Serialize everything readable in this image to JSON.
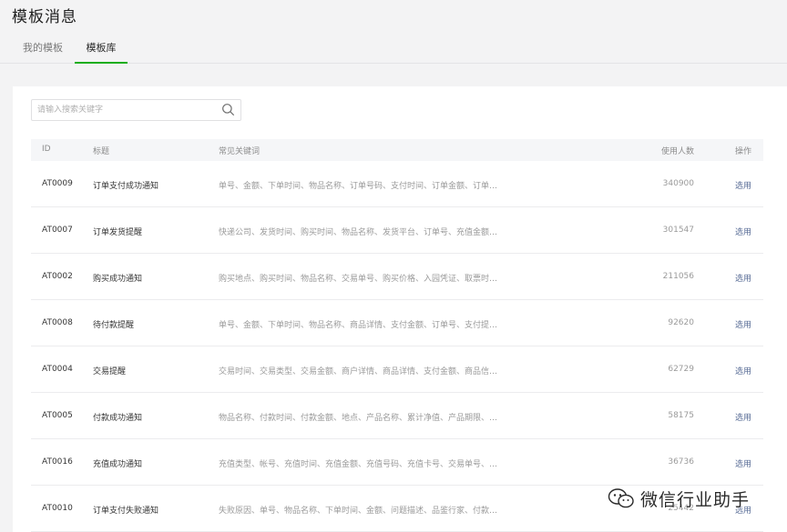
{
  "page": {
    "title": "模板消息"
  },
  "tabs": [
    {
      "label": "我的模板",
      "active": false
    },
    {
      "label": "模板库",
      "active": true
    }
  ],
  "search": {
    "placeholder": "请输入搜索关键字",
    "value": ""
  },
  "table": {
    "headers": {
      "id": "ID",
      "title": "标题",
      "keywords": "常见关键词",
      "users": "使用人数",
      "op": "操作"
    },
    "rows": [
      {
        "id": "AT0009",
        "title": "订单支付成功通知",
        "keywords": "单号、金额、下单时间、物品名称、订单号码、支付时间、订单金额、订单…",
        "users": "340900",
        "op": "选用"
      },
      {
        "id": "AT0007",
        "title": "订单发货提醒",
        "keywords": "快递公司、发货时间、购买时间、物品名称、发货平台、订单号、充值金额…",
        "users": "301547",
        "op": "选用"
      },
      {
        "id": "AT0002",
        "title": "购买成功通知",
        "keywords": "购买地点、购买时间、物品名称、交易单号、购买价格、入园凭证、取票时…",
        "users": "211056",
        "op": "选用"
      },
      {
        "id": "AT0008",
        "title": "待付款提醒",
        "keywords": "单号、金额、下单时间、物品名称、商品详情、支付金额、订单号、支付提…",
        "users": "92620",
        "op": "选用"
      },
      {
        "id": "AT0004",
        "title": "交易提醒",
        "keywords": "交易时间、交易类型、交易金额、商户详情、商品详情、支付金额、商品信…",
        "users": "62729",
        "op": "选用"
      },
      {
        "id": "AT0005",
        "title": "付款成功通知",
        "keywords": "物品名称、付款时间、付款金额、地点、产品名称、累计净值、产品期限、…",
        "users": "58175",
        "op": "选用"
      },
      {
        "id": "AT0016",
        "title": "充值成功通知",
        "keywords": "充值类型、帐号、充值时间、充值金额、充值号码、充值卡号、交易单号、…",
        "users": "36736",
        "op": "选用"
      },
      {
        "id": "AT0010",
        "title": "订单支付失败通知",
        "keywords": "失败原因、单号、物品名称、下单时间、金额、问题描述、品鉴行家、付款…",
        "users": "25442",
        "op": "选用"
      }
    ]
  },
  "watermark": {
    "text": "微信行业助手"
  }
}
